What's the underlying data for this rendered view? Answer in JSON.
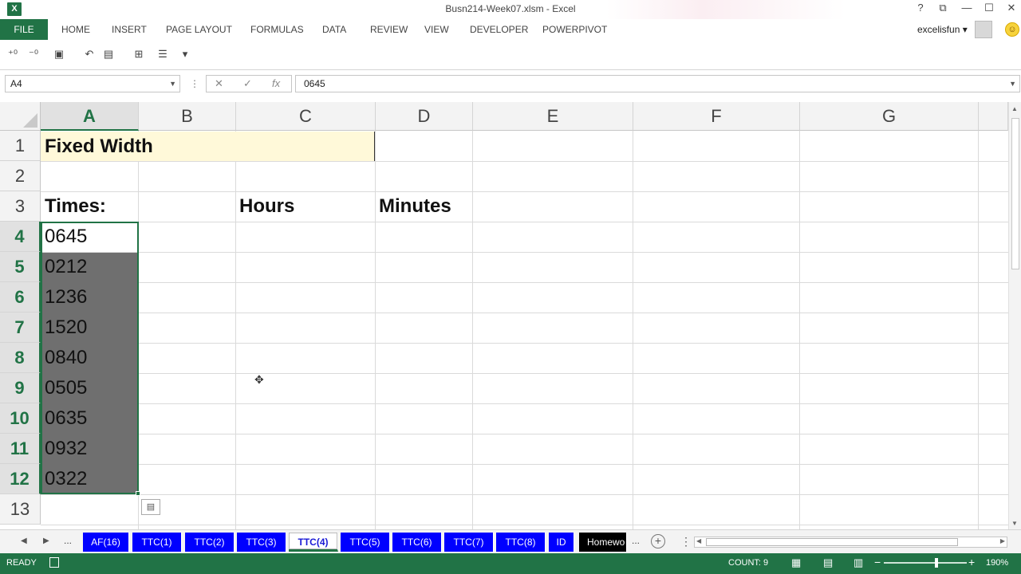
{
  "window": {
    "title": "Busn214-Week07.xlsm - Excel",
    "app_icon": "X",
    "controls": [
      "?",
      "⧉",
      "—",
      "☐",
      "✕"
    ]
  },
  "ribbon": {
    "file_label": "FILE",
    "tabs": [
      "HOME",
      "INSERT",
      "PAGE LAYOUT",
      "FORMULAS",
      "DATA",
      "REVIEW",
      "VIEW",
      "DEVELOPER",
      "POWERPIVOT"
    ],
    "user": "excelisfun ▾"
  },
  "formula_bar": {
    "name_box": "A4",
    "formula": "0645"
  },
  "sheet": {
    "columns": [
      "A",
      "B",
      "C",
      "D",
      "E",
      "F",
      "G"
    ],
    "rows": [
      "1",
      "2",
      "3",
      "4",
      "5",
      "6",
      "7",
      "8",
      "9",
      "10",
      "11",
      "12",
      "13"
    ],
    "title": "Fixed Width",
    "times_label": "Times:",
    "hours_label": "Hours",
    "minutes_label": "Minutes",
    "times": [
      "0645",
      "0212",
      "1236",
      "1520",
      "0840",
      "0505",
      "0635",
      "0932",
      "0322"
    ]
  },
  "sheet_tabs": {
    "tabs": [
      "AF(16)",
      "TTC(1)",
      "TTC(2)",
      "TTC(3)",
      "TTC(4)",
      "TTC(5)",
      "TTC(6)",
      "TTC(7)",
      "TTC(8)",
      "ID",
      "Homewo"
    ],
    "active": "TTC(4)",
    "ellipsis": "..."
  },
  "status_bar": {
    "ready": "READY",
    "count": "COUNT: 9",
    "zoom": "190%"
  },
  "colors": {
    "excel_green": "#217346",
    "tab_blue": "#0000ff",
    "merged_fill": "#fff9d9",
    "selection_fill": "#6f6f6f"
  }
}
